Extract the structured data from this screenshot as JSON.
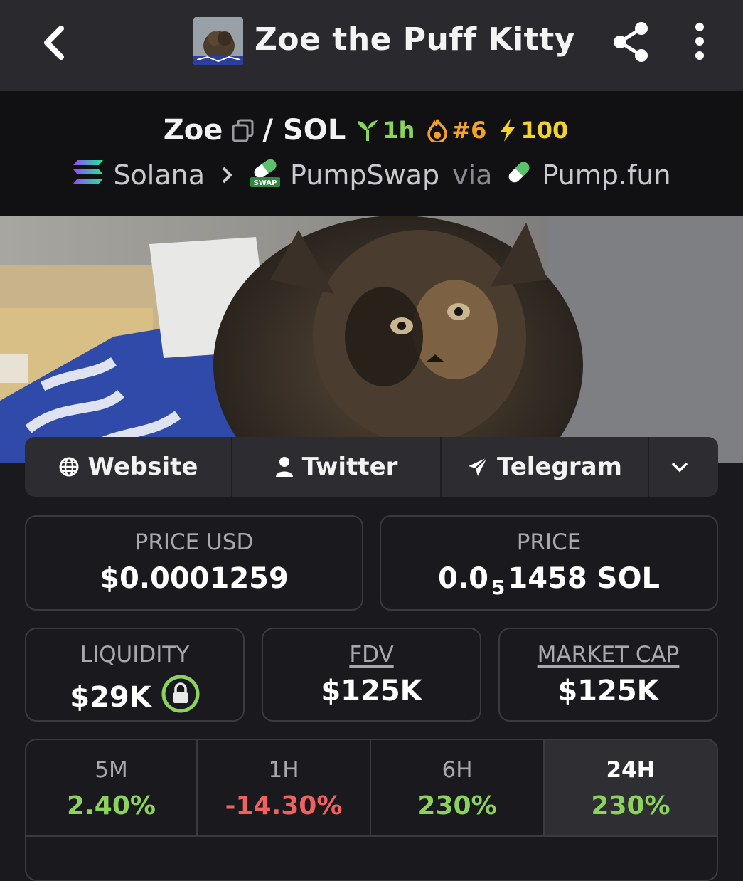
{
  "header": {
    "title": "Zoe the Puff Kitty"
  },
  "pair": {
    "base": "Zoe",
    "separator": "/",
    "quote": "SOL",
    "age_badge": "1h",
    "rank_badge": "#6",
    "boost_badge": "100"
  },
  "route": {
    "chain": "Solana",
    "dex": "PumpSwap",
    "dex_icon_text": "SWAP",
    "via_label": "via",
    "launchpad": "Pump.fun"
  },
  "links": {
    "website": "Website",
    "twitter": "Twitter",
    "telegram": "Telegram"
  },
  "stats": {
    "price_usd_label": "PRICE USD",
    "price_usd_value": "$0.0001259",
    "price_label": "PRICE",
    "price_prefix": "0.0",
    "price_zero_count": "5",
    "price_suffix": "1458 SOL",
    "liquidity_label": "LIQUIDITY",
    "liquidity_value": "$29K",
    "fdv_label": "FDV",
    "fdv_value": "$125K",
    "mcap_label": "MARKET CAP",
    "mcap_value": "$125K"
  },
  "timeframes": [
    {
      "label": "5M",
      "value": "2.40%"
    },
    {
      "label": "1H",
      "value": "-14.30%"
    },
    {
      "label": "6H",
      "value": "230%"
    },
    {
      "label": "24H",
      "value": "230%"
    }
  ],
  "colors": {
    "background": "#1a1a1e",
    "header": "#2a2a2e",
    "positive": "#8bd35e",
    "negative": "#f0615f",
    "rank": "#f2a32c",
    "boost": "#f2d22c"
  }
}
